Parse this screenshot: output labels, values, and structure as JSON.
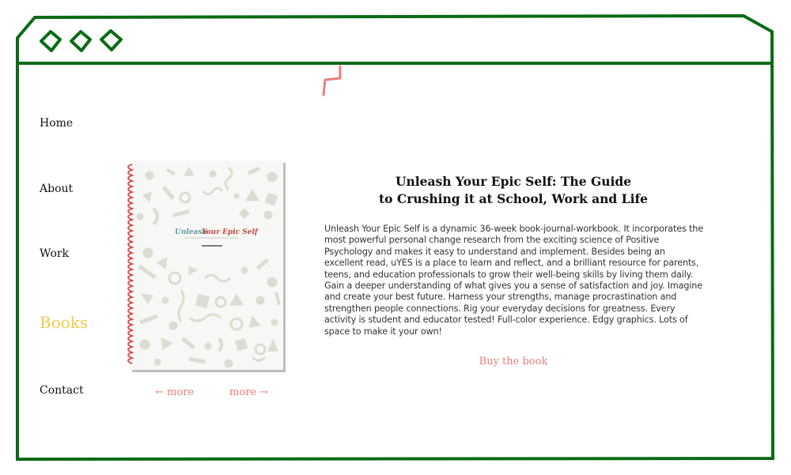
{
  "nav": {
    "items": [
      {
        "label": "Home",
        "active": false
      },
      {
        "label": "About",
        "active": false
      },
      {
        "label": "Work",
        "active": false
      },
      {
        "label": "Books",
        "active": true
      },
      {
        "label": "Contact",
        "active": false
      }
    ]
  },
  "book": {
    "cover_title_part1": "Unleash",
    "cover_title_part2": "Your Epic Self",
    "prev_label": "← more",
    "next_label": "more →",
    "title_line1": "Unleash Your Epic Self: The Guide",
    "title_line2": "to Crushing it at School, Work and Life",
    "description": "Unleash Your Epic Self is a dynamic 36-week book-journal-workbook. It incorporates the most powerful personal change research from the exciting science of Positive Psychology and makes it easy to understand and implement. Besides being an excellent read, uYES is a place to learn and reflect, and a brilliant resource for parents, teens, and education professionals to grow their well-being skills by living them daily. Gain a deeper understanding of what gives you a sense of satisfaction and joy. Imagine and create your best future. Harness your strengths, manage procrastination and strengthen people connections. Rig your everyday decisions for greatness. Every activity is student and educator tested! Full-color experience. Edgy graphics. Lots of space to make it your own!",
    "buy_label": "Buy the book"
  },
  "colors": {
    "frame": "#0a6b14",
    "accent_active": "#f2c94c",
    "link": "#ec7c7c",
    "spiral": "#e0433f",
    "cover_bg": "#f7f7f5",
    "cover_pattern": "#dcdcd2"
  },
  "icons": {
    "window_buttons": [
      "window-dot-icon",
      "window-dot-icon",
      "window-dot-icon"
    ],
    "bookmark": "bookmark-tick-icon"
  }
}
